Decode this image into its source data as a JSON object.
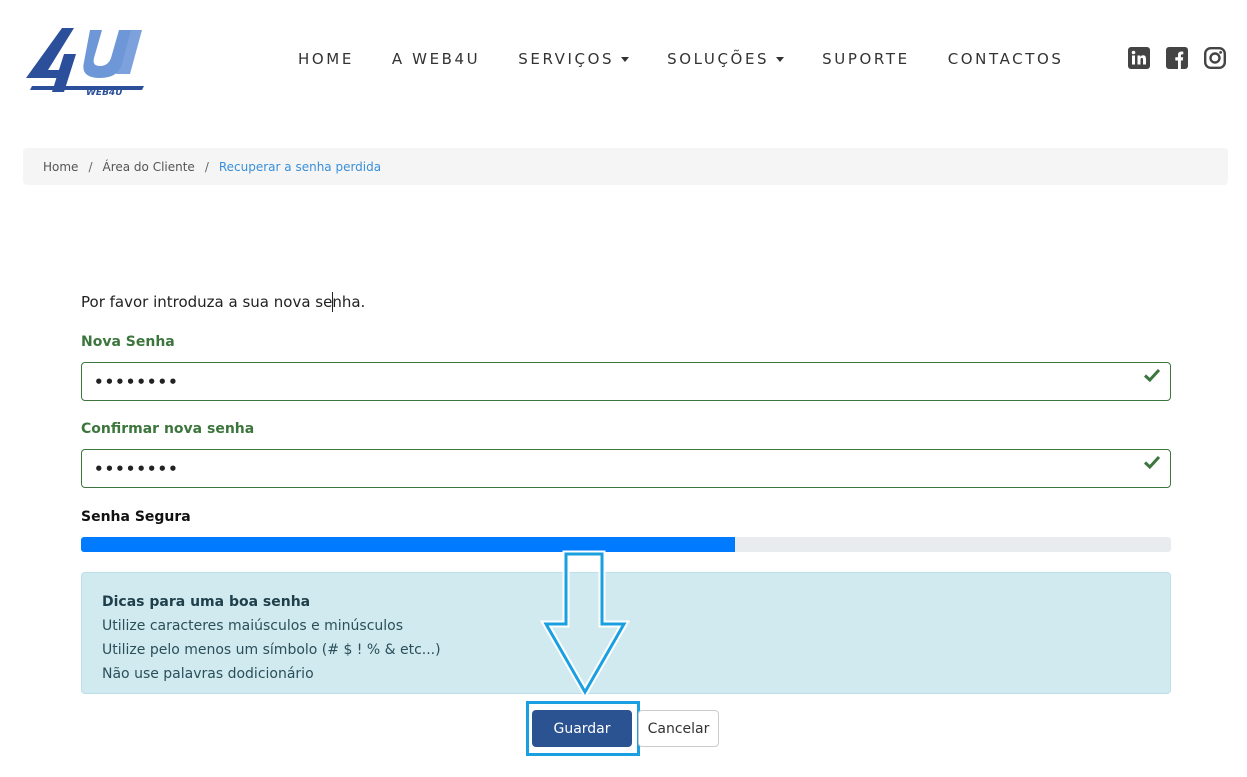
{
  "logo": {
    "mark": "4U",
    "wordmark": "WEB4U",
    "colors": {
      "dark": "#2b4f9a",
      "light": "#6e97d8"
    }
  },
  "nav": {
    "items": [
      {
        "label": "HOME",
        "dropdown": false
      },
      {
        "label": "A WEB4U",
        "dropdown": false
      },
      {
        "label": "SERVIÇOS",
        "dropdown": true
      },
      {
        "label": "SOLUÇÕES",
        "dropdown": true
      },
      {
        "label": "SUPORTE",
        "dropdown": false
      },
      {
        "label": "CONTACTOS",
        "dropdown": false
      }
    ]
  },
  "social": {
    "icons": [
      "linkedin-icon",
      "facebook-icon",
      "instagram-icon"
    ]
  },
  "breadcrumb": {
    "items": [
      "Home",
      "Área do Cliente",
      "Recuperar a senha perdida"
    ],
    "separator": "/"
  },
  "form": {
    "intro": "Por favor introduza a sua nova senha.",
    "new_password": {
      "label": "Nova Senha",
      "value": "••••••••"
    },
    "confirm_password": {
      "label": "Confirmar nova senha",
      "value": "••••••••"
    },
    "strength": {
      "label": "Senha Segura",
      "percent": 60
    },
    "tips": {
      "title": "Dicas para uma boa senha",
      "lines": [
        "Utilize caracteres maiúsculos e minúsculos",
        "Utilize pelo menos um símbolo (# $ ! % & etc...)",
        "Não use palavras dodicionário"
      ]
    },
    "save_label": "Guardar",
    "cancel_label": "Cancelar"
  },
  "colors": {
    "valid_green": "#3c763d",
    "progress_blue": "#007bff",
    "save_button": "#2b5291",
    "annotation_blue": "#1aa0e0"
  }
}
